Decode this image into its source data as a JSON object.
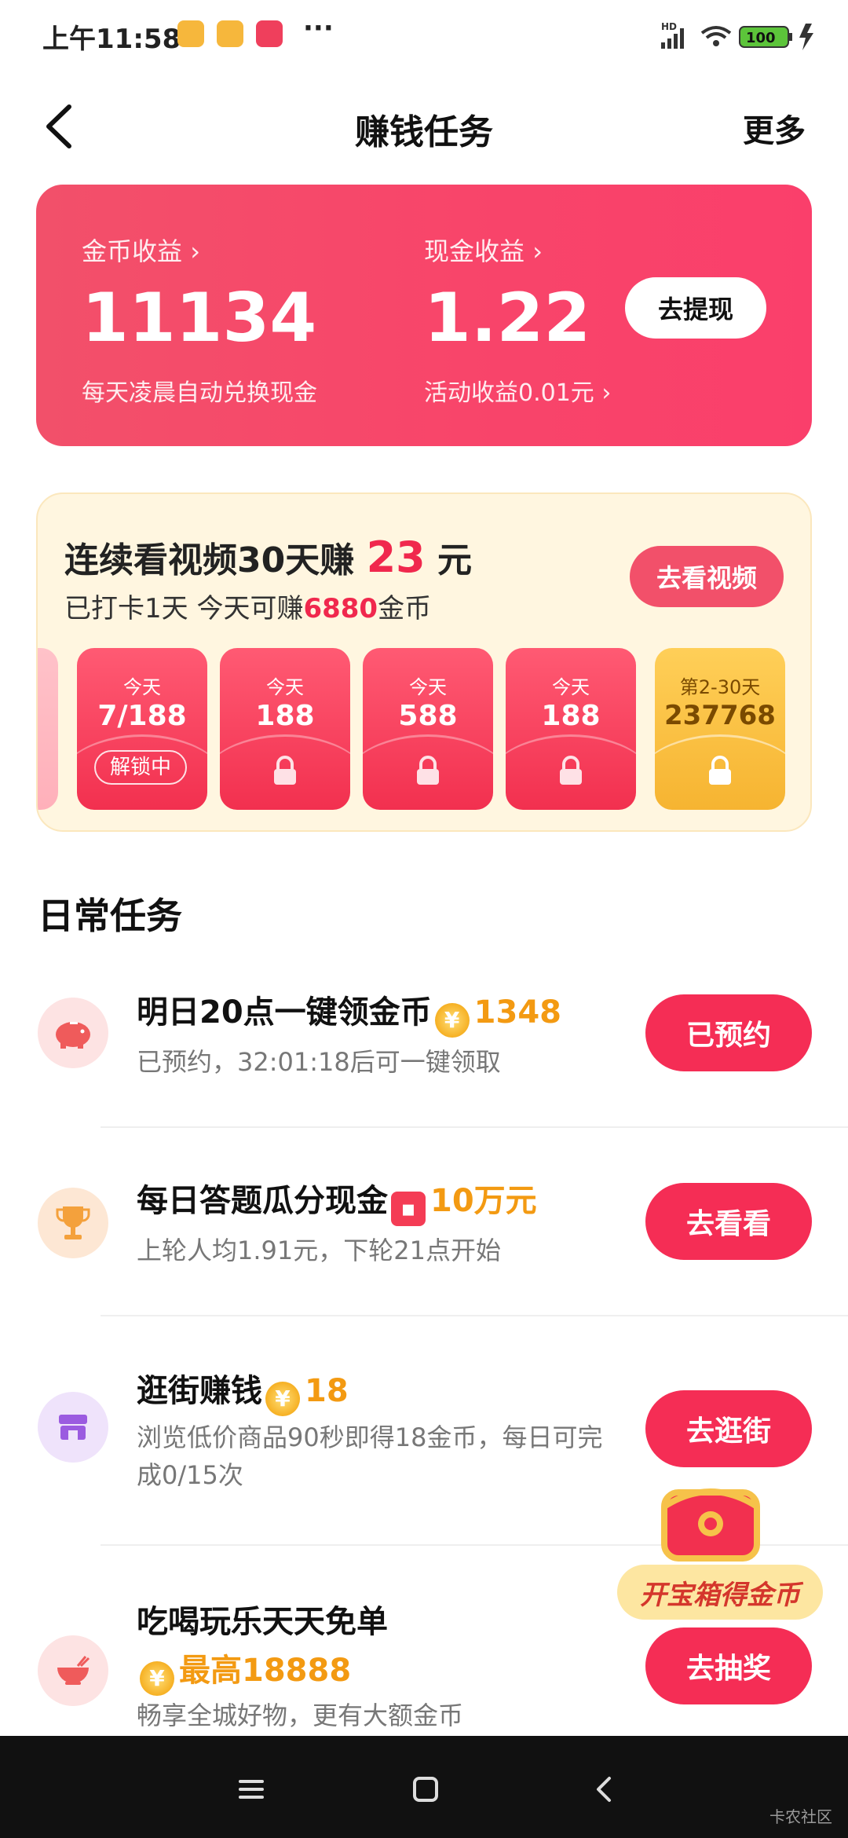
{
  "status_bar": {
    "time": "上午11:58",
    "network": "HD",
    "battery": "100"
  },
  "header": {
    "title": "赚钱任务",
    "more": "更多"
  },
  "earnings": {
    "coin_label": "金币收益",
    "coin_value": "11134",
    "coin_note": "每天凌晨自动兑换现金",
    "cash_label": "现金收益",
    "cash_value": "1.22",
    "cash_note": "活动收益0.01元",
    "withdraw_label": "去提现"
  },
  "checkin": {
    "title_prefix": "连续看视频30天赚",
    "title_amount": "23",
    "title_suffix": "元",
    "sub_prefix": "已打卡1天 今天可赚",
    "sub_highlight": "6880",
    "sub_suffix": "金币",
    "button": "去看视频",
    "envelopes": [
      {
        "day": "今天",
        "amount": "7/188",
        "status": "解锁中"
      },
      {
        "day": "今天",
        "amount": "188"
      },
      {
        "day": "今天",
        "amount": "588"
      },
      {
        "day": "今天",
        "amount": "188"
      },
      {
        "day": "第2-30天",
        "amount": "237768"
      }
    ]
  },
  "daily": {
    "title": "日常任务",
    "tasks": [
      {
        "name": "明日20点一键领金币",
        "reward": "1348",
        "desc": "已预约，32:01:18后可一键领取",
        "button": "已预约"
      },
      {
        "name": "每日答题瓜分现金",
        "reward": "10万元",
        "desc": "上轮人均1.91元，下轮21点开始",
        "button": "去看看"
      },
      {
        "name": "逛街赚钱",
        "reward": "18",
        "desc": "浏览低价商品90秒即得18金币，每日可完成0/15次",
        "button": "去逛街"
      },
      {
        "name": "吃喝玩乐天天免单",
        "reward": "最高18888",
        "desc": "畅享全城好物，更有大额金币",
        "button": "去抽奖"
      }
    ]
  },
  "treasure": {
    "label": "开宝箱得金币"
  },
  "watermark": "卡农社区",
  "colors": {
    "accent": "#f52d55",
    "reward": "#f39a12",
    "card": "#f8456a"
  }
}
